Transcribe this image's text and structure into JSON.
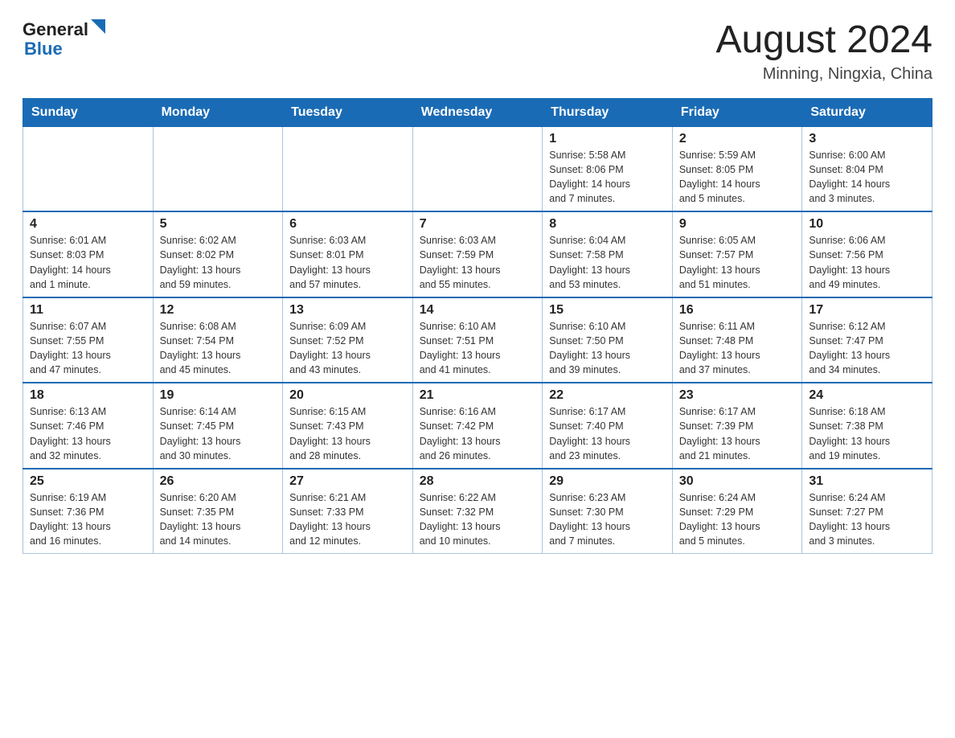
{
  "header": {
    "logo_general": "General",
    "logo_blue": "Blue",
    "month_title": "August 2024",
    "location": "Minning, Ningxia, China"
  },
  "calendar": {
    "days_of_week": [
      "Sunday",
      "Monday",
      "Tuesday",
      "Wednesday",
      "Thursday",
      "Friday",
      "Saturday"
    ],
    "weeks": [
      {
        "days": [
          {
            "number": "",
            "info": ""
          },
          {
            "number": "",
            "info": ""
          },
          {
            "number": "",
            "info": ""
          },
          {
            "number": "",
            "info": ""
          },
          {
            "number": "1",
            "info": "Sunrise: 5:58 AM\nSunset: 8:06 PM\nDaylight: 14 hours\nand 7 minutes."
          },
          {
            "number": "2",
            "info": "Sunrise: 5:59 AM\nSunset: 8:05 PM\nDaylight: 14 hours\nand 5 minutes."
          },
          {
            "number": "3",
            "info": "Sunrise: 6:00 AM\nSunset: 8:04 PM\nDaylight: 14 hours\nand 3 minutes."
          }
        ]
      },
      {
        "days": [
          {
            "number": "4",
            "info": "Sunrise: 6:01 AM\nSunset: 8:03 PM\nDaylight: 14 hours\nand 1 minute."
          },
          {
            "number": "5",
            "info": "Sunrise: 6:02 AM\nSunset: 8:02 PM\nDaylight: 13 hours\nand 59 minutes."
          },
          {
            "number": "6",
            "info": "Sunrise: 6:03 AM\nSunset: 8:01 PM\nDaylight: 13 hours\nand 57 minutes."
          },
          {
            "number": "7",
            "info": "Sunrise: 6:03 AM\nSunset: 7:59 PM\nDaylight: 13 hours\nand 55 minutes."
          },
          {
            "number": "8",
            "info": "Sunrise: 6:04 AM\nSunset: 7:58 PM\nDaylight: 13 hours\nand 53 minutes."
          },
          {
            "number": "9",
            "info": "Sunrise: 6:05 AM\nSunset: 7:57 PM\nDaylight: 13 hours\nand 51 minutes."
          },
          {
            "number": "10",
            "info": "Sunrise: 6:06 AM\nSunset: 7:56 PM\nDaylight: 13 hours\nand 49 minutes."
          }
        ]
      },
      {
        "days": [
          {
            "number": "11",
            "info": "Sunrise: 6:07 AM\nSunset: 7:55 PM\nDaylight: 13 hours\nand 47 minutes."
          },
          {
            "number": "12",
            "info": "Sunrise: 6:08 AM\nSunset: 7:54 PM\nDaylight: 13 hours\nand 45 minutes."
          },
          {
            "number": "13",
            "info": "Sunrise: 6:09 AM\nSunset: 7:52 PM\nDaylight: 13 hours\nand 43 minutes."
          },
          {
            "number": "14",
            "info": "Sunrise: 6:10 AM\nSunset: 7:51 PM\nDaylight: 13 hours\nand 41 minutes."
          },
          {
            "number": "15",
            "info": "Sunrise: 6:10 AM\nSunset: 7:50 PM\nDaylight: 13 hours\nand 39 minutes."
          },
          {
            "number": "16",
            "info": "Sunrise: 6:11 AM\nSunset: 7:48 PM\nDaylight: 13 hours\nand 37 minutes."
          },
          {
            "number": "17",
            "info": "Sunrise: 6:12 AM\nSunset: 7:47 PM\nDaylight: 13 hours\nand 34 minutes."
          }
        ]
      },
      {
        "days": [
          {
            "number": "18",
            "info": "Sunrise: 6:13 AM\nSunset: 7:46 PM\nDaylight: 13 hours\nand 32 minutes."
          },
          {
            "number": "19",
            "info": "Sunrise: 6:14 AM\nSunset: 7:45 PM\nDaylight: 13 hours\nand 30 minutes."
          },
          {
            "number": "20",
            "info": "Sunrise: 6:15 AM\nSunset: 7:43 PM\nDaylight: 13 hours\nand 28 minutes."
          },
          {
            "number": "21",
            "info": "Sunrise: 6:16 AM\nSunset: 7:42 PM\nDaylight: 13 hours\nand 26 minutes."
          },
          {
            "number": "22",
            "info": "Sunrise: 6:17 AM\nSunset: 7:40 PM\nDaylight: 13 hours\nand 23 minutes."
          },
          {
            "number": "23",
            "info": "Sunrise: 6:17 AM\nSunset: 7:39 PM\nDaylight: 13 hours\nand 21 minutes."
          },
          {
            "number": "24",
            "info": "Sunrise: 6:18 AM\nSunset: 7:38 PM\nDaylight: 13 hours\nand 19 minutes."
          }
        ]
      },
      {
        "days": [
          {
            "number": "25",
            "info": "Sunrise: 6:19 AM\nSunset: 7:36 PM\nDaylight: 13 hours\nand 16 minutes."
          },
          {
            "number": "26",
            "info": "Sunrise: 6:20 AM\nSunset: 7:35 PM\nDaylight: 13 hours\nand 14 minutes."
          },
          {
            "number": "27",
            "info": "Sunrise: 6:21 AM\nSunset: 7:33 PM\nDaylight: 13 hours\nand 12 minutes."
          },
          {
            "number": "28",
            "info": "Sunrise: 6:22 AM\nSunset: 7:32 PM\nDaylight: 13 hours\nand 10 minutes."
          },
          {
            "number": "29",
            "info": "Sunrise: 6:23 AM\nSunset: 7:30 PM\nDaylight: 13 hours\nand 7 minutes."
          },
          {
            "number": "30",
            "info": "Sunrise: 6:24 AM\nSunset: 7:29 PM\nDaylight: 13 hours\nand 5 minutes."
          },
          {
            "number": "31",
            "info": "Sunrise: 6:24 AM\nSunset: 7:27 PM\nDaylight: 13 hours\nand 3 minutes."
          }
        ]
      }
    ]
  }
}
